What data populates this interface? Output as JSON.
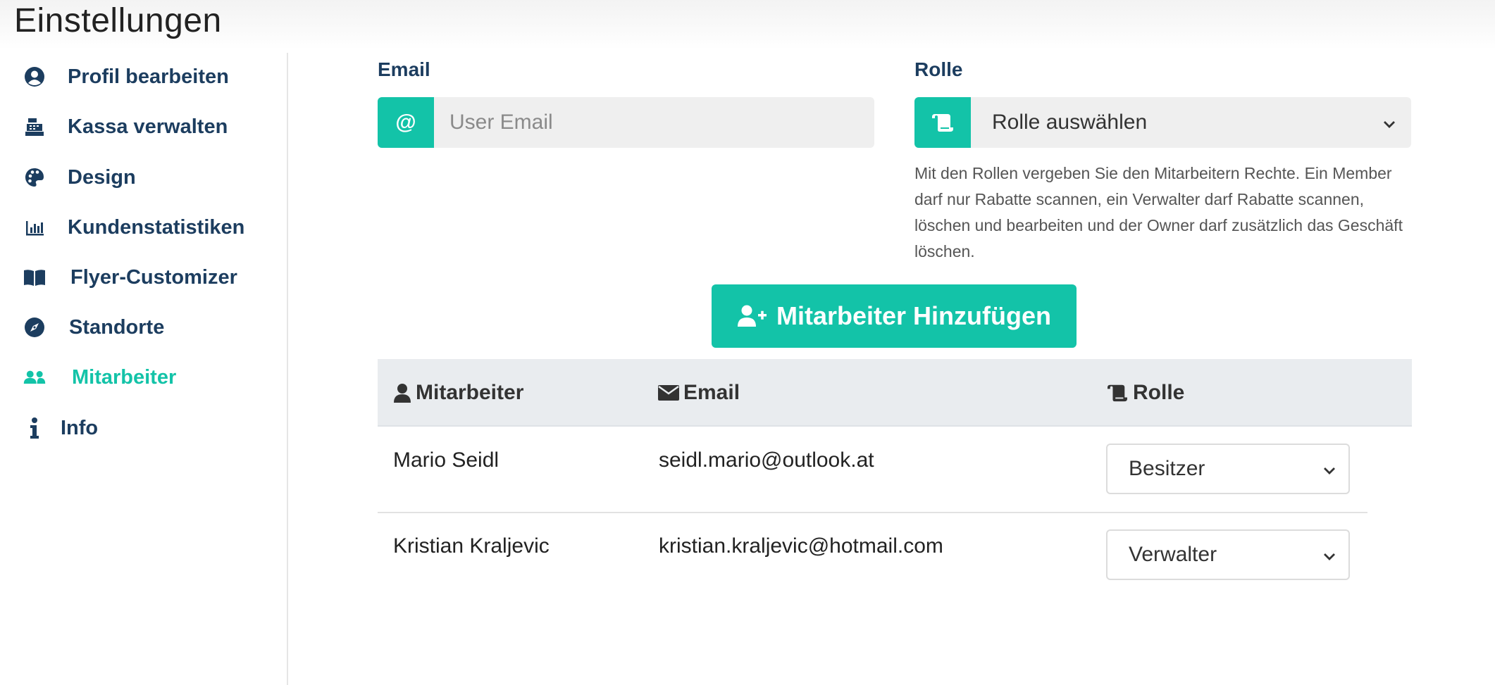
{
  "page": {
    "title": "Einstellungen"
  },
  "sidebar": {
    "items": [
      {
        "label": "Profil bearbeiten",
        "icon": "user-circle-icon"
      },
      {
        "label": "Kassa verwalten",
        "icon": "cash-register-icon"
      },
      {
        "label": "Design",
        "icon": "palette-icon"
      },
      {
        "label": "Kundenstatistiken",
        "icon": "bar-chart-icon"
      },
      {
        "label": "Flyer-Customizer",
        "icon": "book-open-icon"
      },
      {
        "label": "Standorte",
        "icon": "compass-icon"
      },
      {
        "label": "Mitarbeiter",
        "icon": "users-icon",
        "active": true
      },
      {
        "label": "Info",
        "icon": "info-icon"
      }
    ]
  },
  "form": {
    "email": {
      "label": "Email",
      "addon": "@",
      "placeholder": "User Email",
      "value": ""
    },
    "role": {
      "label": "Rolle",
      "selected": "Rolle auswählen",
      "help": "Mit den Rollen vergeben Sie den Mitarbeitern Rechte. Ein Member darf nur Rabatte scannen, ein Verwalter darf Rabatte scannen, löschen und bearbeiten und der Owner darf zusätzlich das Geschäft löschen."
    },
    "add_button": "Mitarbeiter Hinzufügen"
  },
  "table": {
    "headers": {
      "employee": "Mitarbeiter",
      "email": "Email",
      "role": "Rolle"
    },
    "rows": [
      {
        "name": "Mario Seidl",
        "email": "seidl.mario@outlook.at",
        "role": "Besitzer"
      },
      {
        "name": "Kristian Kraljevic",
        "email": "kristian.kraljevic@hotmail.com",
        "role": "Verwalter"
      }
    ]
  },
  "colors": {
    "accent": "#13c3a8",
    "navy": "#1c3d5f",
    "header_bg": "#e9ecef"
  }
}
